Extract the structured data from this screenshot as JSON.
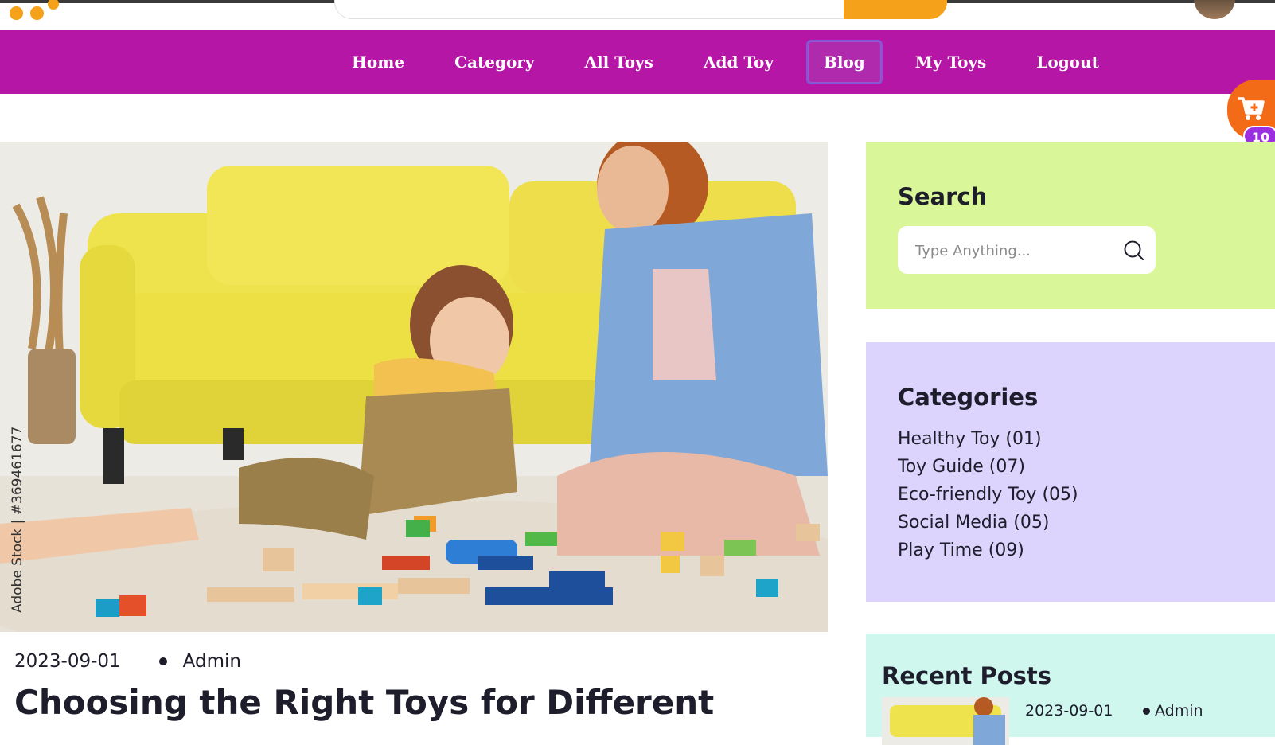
{
  "nav": {
    "items": [
      {
        "label": "Home"
      },
      {
        "label": "Category"
      },
      {
        "label": "All Toys"
      },
      {
        "label": "Add Toy"
      },
      {
        "label": "Blog",
        "active": true
      },
      {
        "label": "My Toys"
      },
      {
        "label": "Logout"
      }
    ]
  },
  "cart": {
    "count": "10",
    "icon": "cart-plus-icon"
  },
  "post": {
    "date": "2023-09-01",
    "author": "Admin",
    "title": "Choosing the Right Toys for Different",
    "image_watermark": "Adobe Stock | #369461677"
  },
  "sidebar": {
    "search": {
      "title": "Search",
      "placeholder": "Type Anything...",
      "icon": "search-icon"
    },
    "categories": {
      "title": "Categories",
      "items": [
        {
          "label": "Healthy Toy (01)"
        },
        {
          "label": "Toy Guide (07)"
        },
        {
          "label": "Eco-friendly Toy (05)"
        },
        {
          "label": "Social Media (05)"
        },
        {
          "label": "Play Time (09)"
        }
      ]
    },
    "recent": {
      "title": "Recent Posts",
      "items": [
        {
          "date": "2023-09-01",
          "author": "Admin"
        }
      ]
    }
  },
  "colors": {
    "nav_bg": "#b516a6",
    "accent_orange": "#f36b17",
    "search_widget_bg": "#d9f799",
    "categories_widget_bg": "#dcd4fd",
    "recent_widget_bg": "#cff7ee"
  }
}
